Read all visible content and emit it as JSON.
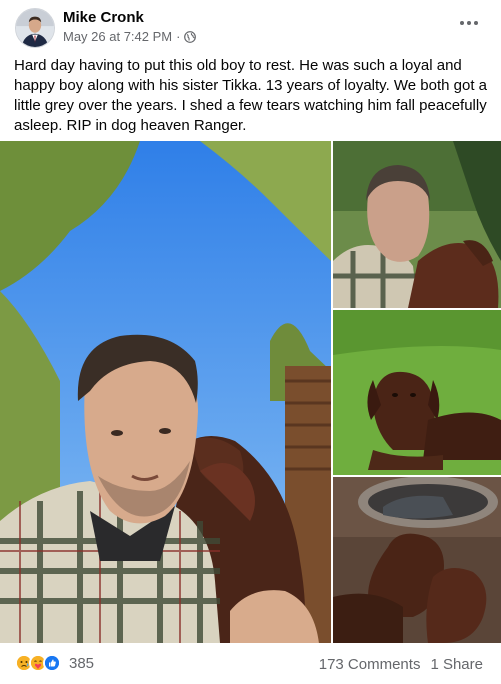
{
  "post": {
    "author": "Mike Cronk",
    "timestamp": "May 26 at 7:42 PM",
    "separator": "·",
    "privacy_icon": "globe-icon",
    "more_icon": "ellipsis-icon",
    "text": "Hard day having to put this old boy to rest. He was such a loyal and happy boy along with his sister Tikka. 13 years of loyalty. We both got a little grey over the years. I shed a few tears watching him fall peacefully asleep. RIP in dog heaven Ranger."
  },
  "photos": [
    {
      "id": "main",
      "subject": "man selfie with dog licking his face"
    },
    {
      "id": "a",
      "subject": "man with dog"
    },
    {
      "id": "b",
      "subject": "dog lying on grass"
    },
    {
      "id": "c",
      "subject": "two dogs indoors"
    }
  ],
  "footer": {
    "reaction_icons": [
      "sad-reaction-icon",
      "care-reaction-icon",
      "like-reaction-icon"
    ],
    "reaction_count": "385",
    "comments": "173 Comments",
    "shares": "1 Share"
  },
  "colors": {
    "text": "#050505",
    "secondary": "#65676b",
    "like_blue": "#1877f2",
    "reaction_yellow": "#f7b125"
  }
}
